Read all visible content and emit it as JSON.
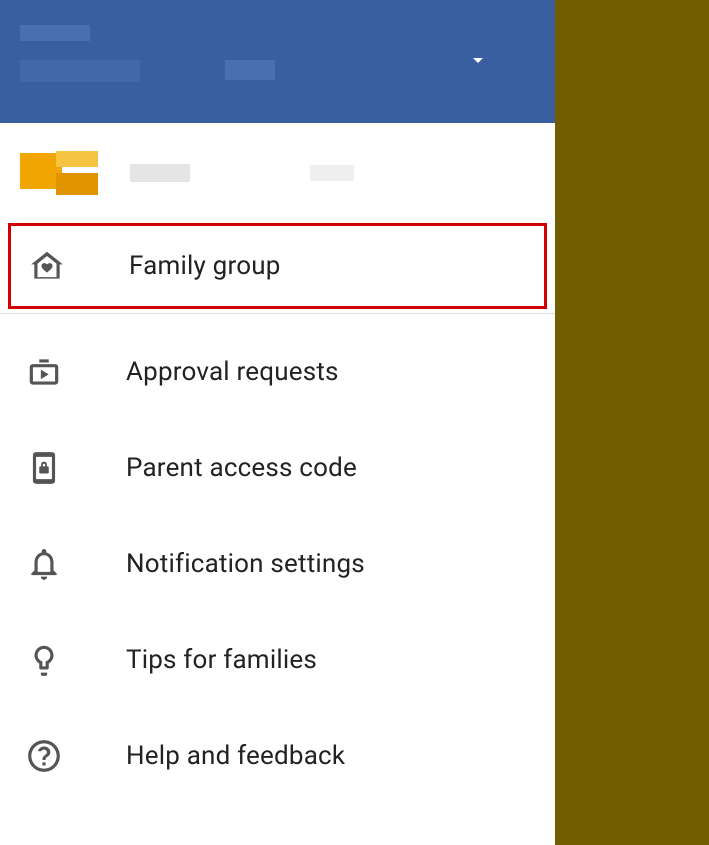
{
  "menu": {
    "familyGroup": "Family group",
    "approvalRequests": "Approval requests",
    "parentAccessCode": "Parent access code",
    "notificationSettings": "Notification settings",
    "tipsForFamilies": "Tips for families",
    "helpAndFeedback": "Help and feedback"
  }
}
